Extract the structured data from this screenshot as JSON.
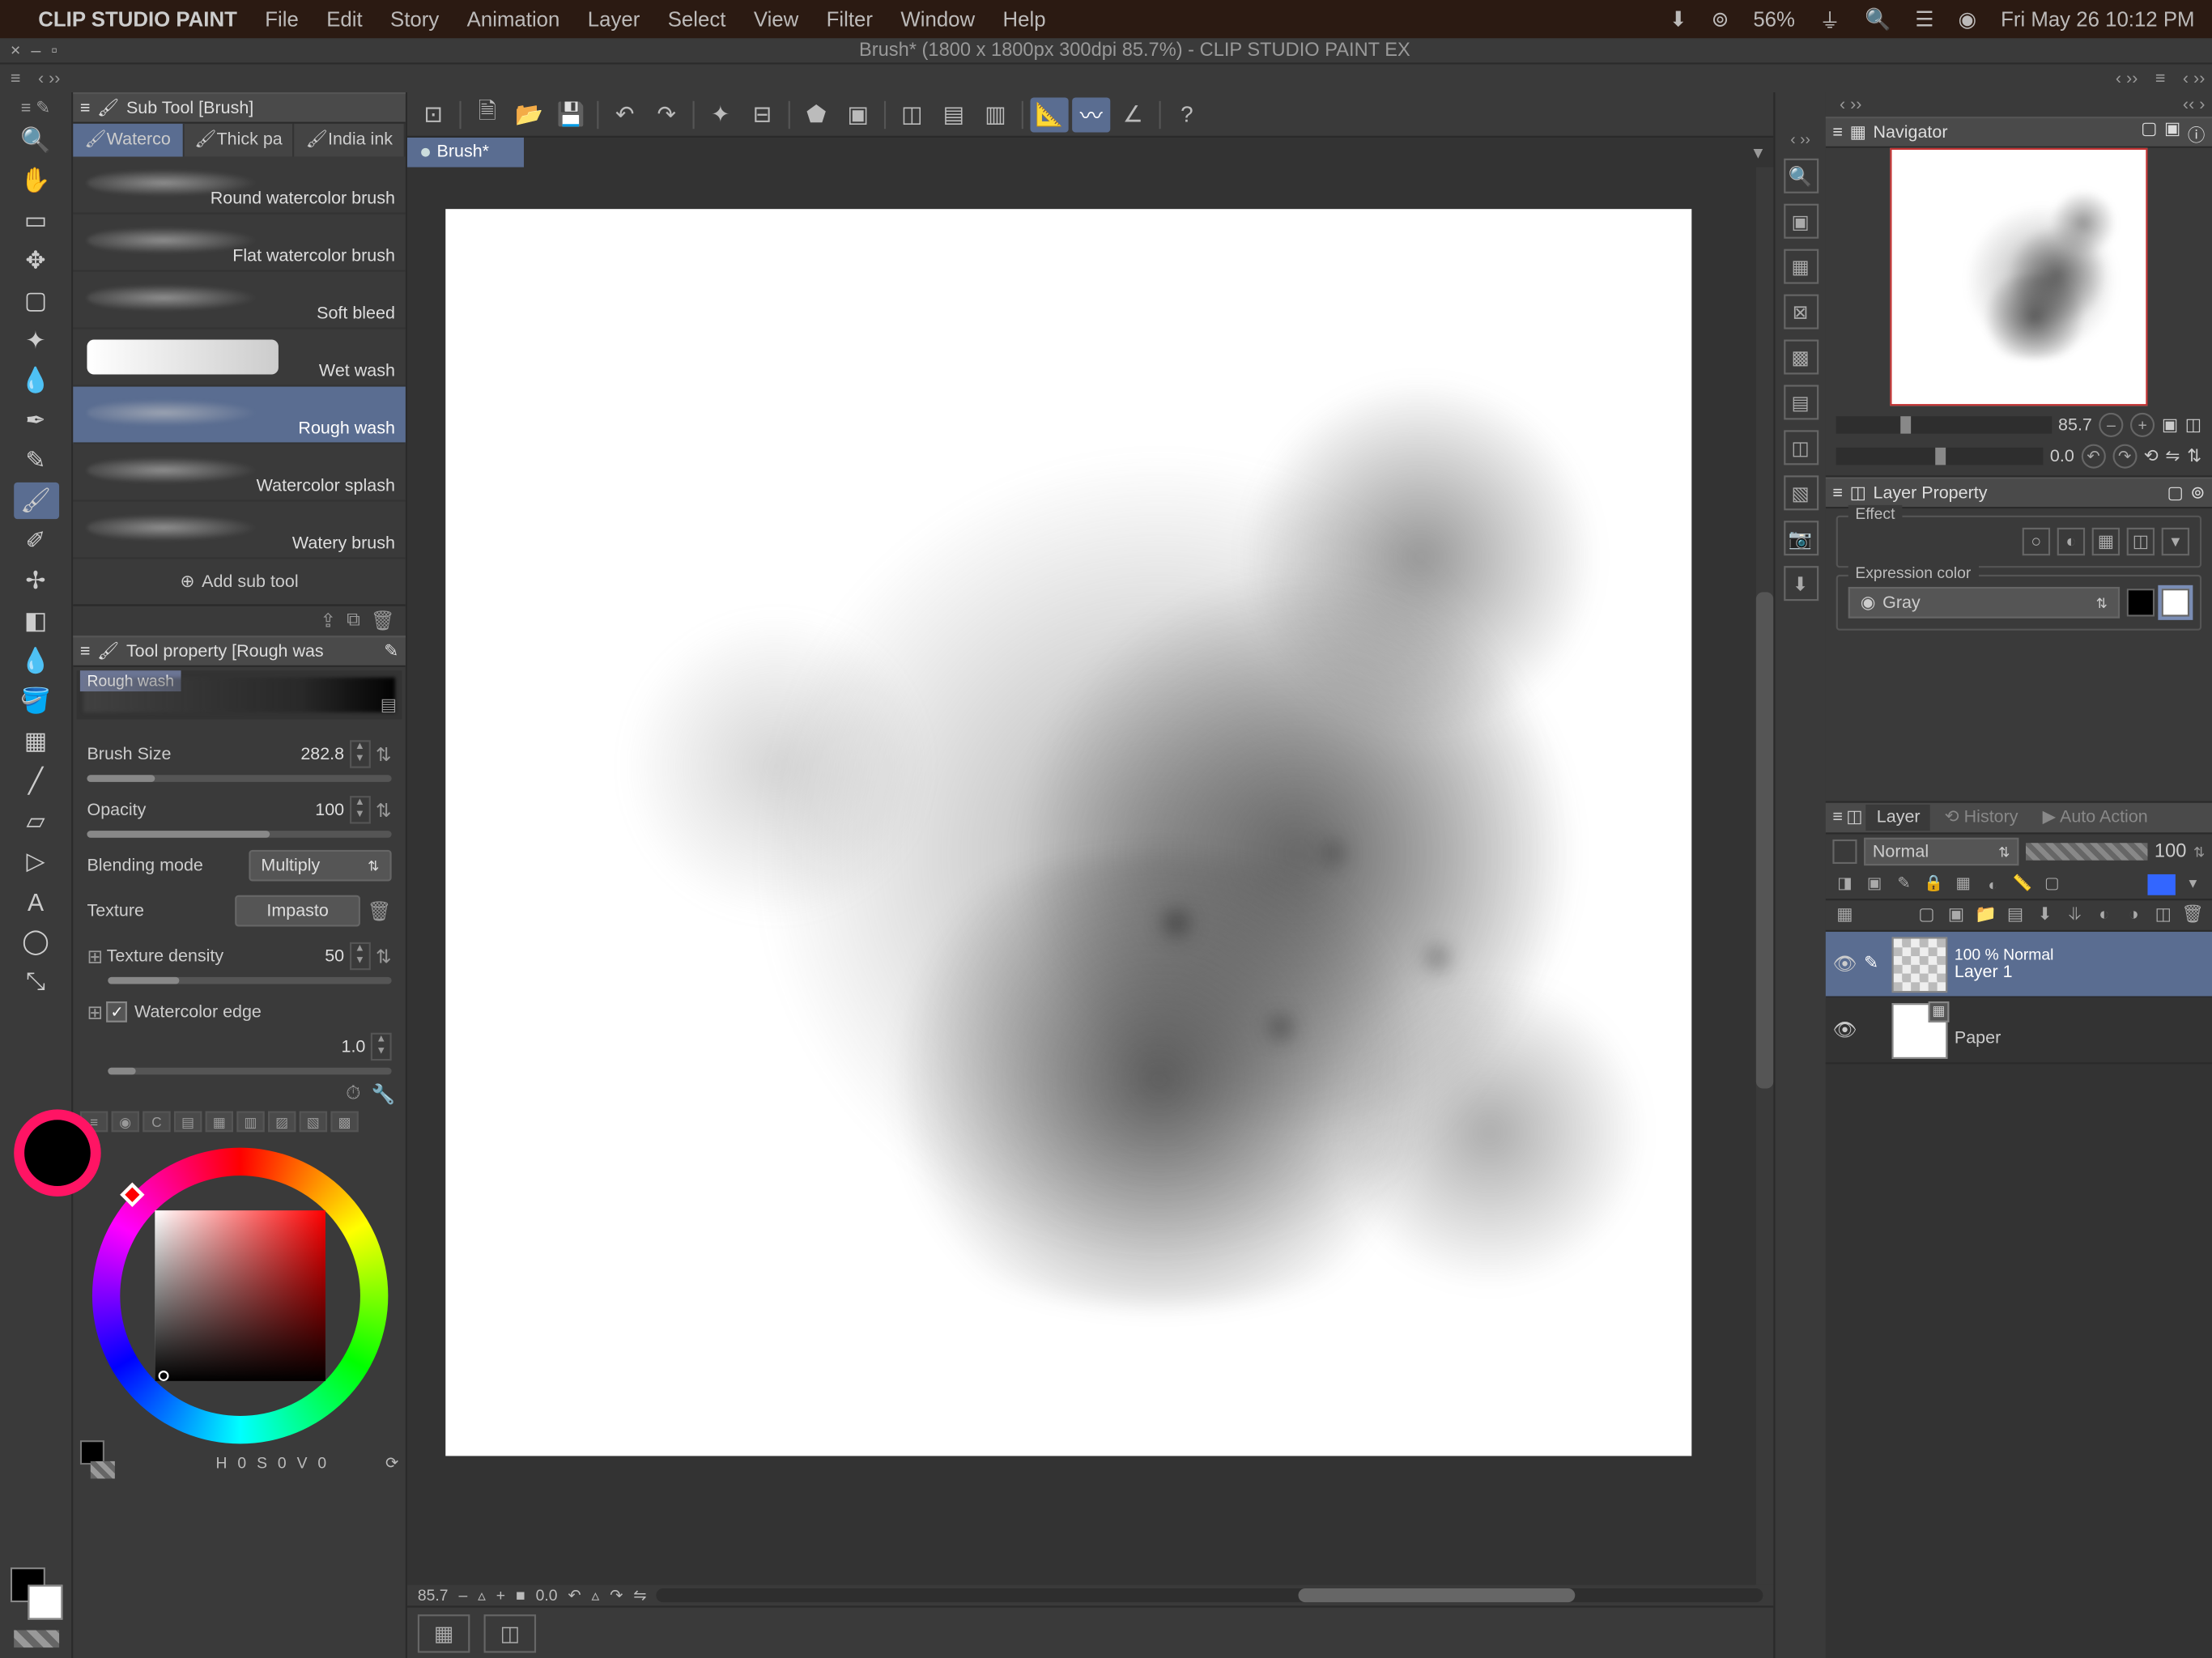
{
  "menubar": {
    "app": "CLIP STUDIO PAINT",
    "items": [
      "File",
      "Edit",
      "Story",
      "Animation",
      "Layer",
      "Select",
      "View",
      "Filter",
      "Window",
      "Help"
    ],
    "clock": "Fri May 26  10:12 PM",
    "battery": "56%"
  },
  "window": {
    "title": "Brush* (1800 x 1800px 300dpi 85.7%)  -  CLIP STUDIO PAINT EX"
  },
  "doctab": {
    "name": "Brush*"
  },
  "subtool": {
    "panel_title": "Sub Tool [Brush]",
    "tabs": [
      "Waterco",
      "Thick pa",
      "India ink"
    ],
    "items": [
      "Round watercolor brush",
      "Flat watercolor brush",
      "Soft bleed",
      "Wet wash",
      "Rough wash",
      "Watercolor splash",
      "Watery brush"
    ],
    "selected_index": 4,
    "add_label": "Add sub tool"
  },
  "toolprop": {
    "panel_title": "Tool property [Rough was",
    "preview_label": "Rough wash",
    "brush_size_label": "Brush Size",
    "brush_size_value": "282.8",
    "opacity_label": "Opacity",
    "opacity_value": "100",
    "blend_label": "Blending mode",
    "blend_value": "Multiply",
    "texture_label": "Texture",
    "texture_value": "Impasto",
    "texdensity_label": "Texture density",
    "texdensity_value": "50",
    "wedge_label": "Watercolor edge",
    "wedge_value": "1.0"
  },
  "navigator": {
    "panel_title": "Navigator",
    "zoom": "85.7",
    "angle": "0.0"
  },
  "layerprop": {
    "panel_title": "Layer Property",
    "effect_label": "Effect",
    "expr_label": "Expression color",
    "expr_value": "Gray"
  },
  "layerpanel": {
    "tabs": [
      "Layer",
      "History",
      "Auto Action"
    ],
    "blend_mode": "Normal",
    "opacity": "100",
    "layers": [
      {
        "opacity_mode": "100 %  Normal",
        "name": "Layer 1",
        "selected": true,
        "checker": true
      },
      {
        "opacity_mode": "",
        "name": "Paper",
        "selected": false,
        "checker": false
      }
    ]
  },
  "statusbar": {
    "zoom": "85.7",
    "angle": "0.0"
  },
  "colorfoot": {
    "h": "H",
    "hval": "0",
    "s": "S",
    "sval": "0",
    "v": "V",
    "vval": "0"
  }
}
